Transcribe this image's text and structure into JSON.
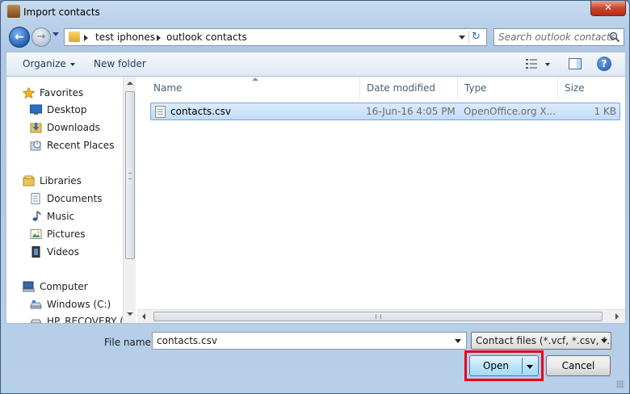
{
  "window": {
    "title": "Import contacts",
    "close_label": "✕"
  },
  "nav": {
    "breadcrumbs": [
      "test iphones",
      "outlook contacts"
    ],
    "search_placeholder": "Search outlook contacts"
  },
  "toolbar": {
    "organize_label": "Organize",
    "new_folder_label": "New folder"
  },
  "sidebar": {
    "items": [
      {
        "label": "Favorites",
        "icon": "star-icon"
      },
      {
        "label": "Desktop",
        "icon": "desktop-icon"
      },
      {
        "label": "Downloads",
        "icon": "downloads-icon"
      },
      {
        "label": "Recent Places",
        "icon": "recent-places-icon"
      },
      {
        "label": "Libraries",
        "icon": "libraries-icon"
      },
      {
        "label": "Documents",
        "icon": "documents-icon"
      },
      {
        "label": "Music",
        "icon": "music-icon"
      },
      {
        "label": "Pictures",
        "icon": "pictures-icon"
      },
      {
        "label": "Videos",
        "icon": "videos-icon"
      },
      {
        "label": "Computer",
        "icon": "computer-icon"
      },
      {
        "label": "Windows (C:)",
        "icon": "drive-icon"
      },
      {
        "label": "HP_RECOVERY (D",
        "icon": "drive-icon"
      }
    ]
  },
  "files": {
    "columns": [
      "Name",
      "Date modified",
      "Type",
      "Size"
    ],
    "rows": [
      {
        "name": "contacts.csv",
        "date": "16-Jun-16 4:05 PM",
        "type": "OpenOffice.org X...",
        "size": "1 KB"
      }
    ]
  },
  "bottom": {
    "filename_label": "File name:",
    "filename_value": "contacts.csv",
    "filetype_value": "Contact files (*.vcf, *.csv, *.xls",
    "open_label": "Open",
    "cancel_label": "Cancel"
  },
  "colors": {
    "highlight": "#e10a17",
    "selection": "#c1dcfa",
    "accent": "#1f5fb3"
  }
}
